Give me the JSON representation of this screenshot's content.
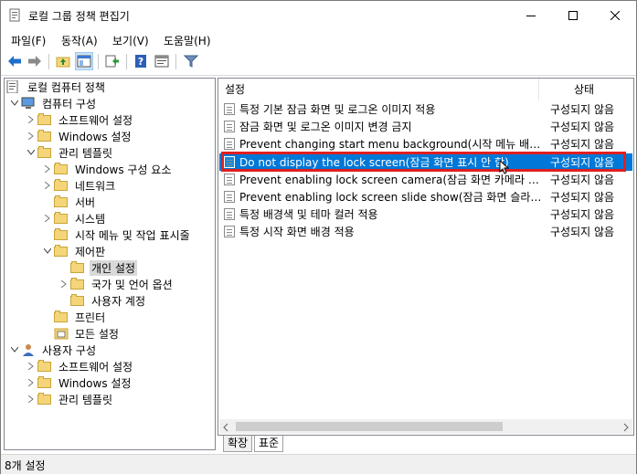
{
  "window": {
    "title": "로컬 그룹 정책 편집기"
  },
  "menu": [
    "파일(F)",
    "동작(A)",
    "보기(V)",
    "도움말(H)"
  ],
  "toolbar": {
    "buttons": [
      "back-arrow",
      "forward-arrow",
      "up-folder",
      "show-hide-tree",
      "export-list",
      "help",
      "properties",
      "filter"
    ]
  },
  "tree": {
    "nodes": [
      {
        "label": "로컬 컴퓨터 정책",
        "icon": "computer-policy"
      },
      {
        "label": "컴퓨터 구성",
        "icon": "computer"
      },
      {
        "label": "소프트웨어 설정",
        "icon": "folder"
      },
      {
        "label": "Windows 설정",
        "icon": "folder"
      },
      {
        "label": "관리 템플릿",
        "icon": "folder"
      },
      {
        "label": "Windows 구성 요소",
        "icon": "folder"
      },
      {
        "label": "네트워크",
        "icon": "folder"
      },
      {
        "label": "서버",
        "icon": "folder"
      },
      {
        "label": "시스템",
        "icon": "folder"
      },
      {
        "label": "시작 메뉴 및 작업 표시줄",
        "icon": "folder"
      },
      {
        "label": "제어판",
        "icon": "folder-open"
      },
      {
        "label": "개인 설정",
        "icon": "folder"
      },
      {
        "label": "국가 및 언어 옵션",
        "icon": "folder"
      },
      {
        "label": "사용자 계정",
        "icon": "folder"
      },
      {
        "label": "프린터",
        "icon": "folder"
      },
      {
        "label": "모든 설정",
        "icon": "all-settings"
      },
      {
        "label": "사용자 구성",
        "icon": "user"
      },
      {
        "label": "소프트웨어 설정",
        "icon": "folder"
      },
      {
        "label": "Windows 설정",
        "icon": "folder"
      },
      {
        "label": "관리 템플릿",
        "icon": "folder"
      }
    ]
  },
  "list": {
    "col_setting": "설정",
    "col_state": "상태",
    "rows": [
      {
        "name": "특정 기본 잠금 화면 및 로그온 이미지 적용",
        "state": "구성되지 않음"
      },
      {
        "name": "잠금 화면 및 로그온 이미지 변경 금지",
        "state": "구성되지 않음"
      },
      {
        "name": "Prevent changing start menu background(시작 메뉴 배경 ...",
        "state": "구성되지 않음"
      },
      {
        "name": "Do not display the lock screen(잠금 화면 표시 안 함)",
        "state": "구성되지 않음"
      },
      {
        "name": "Prevent enabling lock screen camera(잠금 화면 카메라 사...",
        "state": "구성되지 않음"
      },
      {
        "name": "Prevent enabling lock screen slide show(잠금 화면 슬라이...",
        "state": "구성되지 않음"
      },
      {
        "name": "특정 배경색 및 테마 컬러 적용",
        "state": "구성되지 않음"
      },
      {
        "name": "특정 시작 화면 배경 적용",
        "state": "구성되지 않음"
      }
    ],
    "selected_index": 3
  },
  "tabs": [
    "확장",
    "표준"
  ],
  "status": {
    "text": "8개 설정"
  },
  "colors": {
    "selection": "#0078d7",
    "highlight_box": "#e01f1f"
  }
}
